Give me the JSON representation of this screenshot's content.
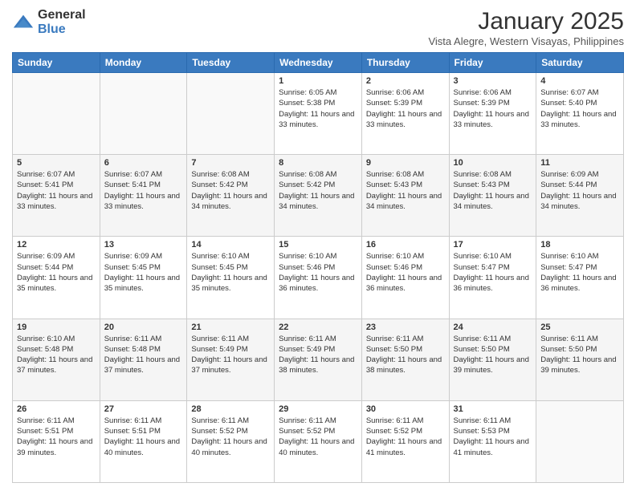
{
  "logo": {
    "general": "General",
    "blue": "Blue"
  },
  "header": {
    "month": "January 2025",
    "subtitle": "Vista Alegre, Western Visayas, Philippines"
  },
  "weekdays": [
    "Sunday",
    "Monday",
    "Tuesday",
    "Wednesday",
    "Thursday",
    "Friday",
    "Saturday"
  ],
  "weeks": [
    [
      {
        "day": "",
        "info": ""
      },
      {
        "day": "",
        "info": ""
      },
      {
        "day": "",
        "info": ""
      },
      {
        "day": "1",
        "info": "Sunrise: 6:05 AM\nSunset: 5:38 PM\nDaylight: 11 hours and 33 minutes."
      },
      {
        "day": "2",
        "info": "Sunrise: 6:06 AM\nSunset: 5:39 PM\nDaylight: 11 hours and 33 minutes."
      },
      {
        "day": "3",
        "info": "Sunrise: 6:06 AM\nSunset: 5:39 PM\nDaylight: 11 hours and 33 minutes."
      },
      {
        "day": "4",
        "info": "Sunrise: 6:07 AM\nSunset: 5:40 PM\nDaylight: 11 hours and 33 minutes."
      }
    ],
    [
      {
        "day": "5",
        "info": "Sunrise: 6:07 AM\nSunset: 5:41 PM\nDaylight: 11 hours and 33 minutes."
      },
      {
        "day": "6",
        "info": "Sunrise: 6:07 AM\nSunset: 5:41 PM\nDaylight: 11 hours and 33 minutes."
      },
      {
        "day": "7",
        "info": "Sunrise: 6:08 AM\nSunset: 5:42 PM\nDaylight: 11 hours and 34 minutes."
      },
      {
        "day": "8",
        "info": "Sunrise: 6:08 AM\nSunset: 5:42 PM\nDaylight: 11 hours and 34 minutes."
      },
      {
        "day": "9",
        "info": "Sunrise: 6:08 AM\nSunset: 5:43 PM\nDaylight: 11 hours and 34 minutes."
      },
      {
        "day": "10",
        "info": "Sunrise: 6:08 AM\nSunset: 5:43 PM\nDaylight: 11 hours and 34 minutes."
      },
      {
        "day": "11",
        "info": "Sunrise: 6:09 AM\nSunset: 5:44 PM\nDaylight: 11 hours and 34 minutes."
      }
    ],
    [
      {
        "day": "12",
        "info": "Sunrise: 6:09 AM\nSunset: 5:44 PM\nDaylight: 11 hours and 35 minutes."
      },
      {
        "day": "13",
        "info": "Sunrise: 6:09 AM\nSunset: 5:45 PM\nDaylight: 11 hours and 35 minutes."
      },
      {
        "day": "14",
        "info": "Sunrise: 6:10 AM\nSunset: 5:45 PM\nDaylight: 11 hours and 35 minutes."
      },
      {
        "day": "15",
        "info": "Sunrise: 6:10 AM\nSunset: 5:46 PM\nDaylight: 11 hours and 36 minutes."
      },
      {
        "day": "16",
        "info": "Sunrise: 6:10 AM\nSunset: 5:46 PM\nDaylight: 11 hours and 36 minutes."
      },
      {
        "day": "17",
        "info": "Sunrise: 6:10 AM\nSunset: 5:47 PM\nDaylight: 11 hours and 36 minutes."
      },
      {
        "day": "18",
        "info": "Sunrise: 6:10 AM\nSunset: 5:47 PM\nDaylight: 11 hours and 36 minutes."
      }
    ],
    [
      {
        "day": "19",
        "info": "Sunrise: 6:10 AM\nSunset: 5:48 PM\nDaylight: 11 hours and 37 minutes."
      },
      {
        "day": "20",
        "info": "Sunrise: 6:11 AM\nSunset: 5:48 PM\nDaylight: 11 hours and 37 minutes."
      },
      {
        "day": "21",
        "info": "Sunrise: 6:11 AM\nSunset: 5:49 PM\nDaylight: 11 hours and 37 minutes."
      },
      {
        "day": "22",
        "info": "Sunrise: 6:11 AM\nSunset: 5:49 PM\nDaylight: 11 hours and 38 minutes."
      },
      {
        "day": "23",
        "info": "Sunrise: 6:11 AM\nSunset: 5:50 PM\nDaylight: 11 hours and 38 minutes."
      },
      {
        "day": "24",
        "info": "Sunrise: 6:11 AM\nSunset: 5:50 PM\nDaylight: 11 hours and 39 minutes."
      },
      {
        "day": "25",
        "info": "Sunrise: 6:11 AM\nSunset: 5:50 PM\nDaylight: 11 hours and 39 minutes."
      }
    ],
    [
      {
        "day": "26",
        "info": "Sunrise: 6:11 AM\nSunset: 5:51 PM\nDaylight: 11 hours and 39 minutes."
      },
      {
        "day": "27",
        "info": "Sunrise: 6:11 AM\nSunset: 5:51 PM\nDaylight: 11 hours and 40 minutes."
      },
      {
        "day": "28",
        "info": "Sunrise: 6:11 AM\nSunset: 5:52 PM\nDaylight: 11 hours and 40 minutes."
      },
      {
        "day": "29",
        "info": "Sunrise: 6:11 AM\nSunset: 5:52 PM\nDaylight: 11 hours and 40 minutes."
      },
      {
        "day": "30",
        "info": "Sunrise: 6:11 AM\nSunset: 5:52 PM\nDaylight: 11 hours and 41 minutes."
      },
      {
        "day": "31",
        "info": "Sunrise: 6:11 AM\nSunset: 5:53 PM\nDaylight: 11 hours and 41 minutes."
      },
      {
        "day": "",
        "info": ""
      }
    ]
  ]
}
